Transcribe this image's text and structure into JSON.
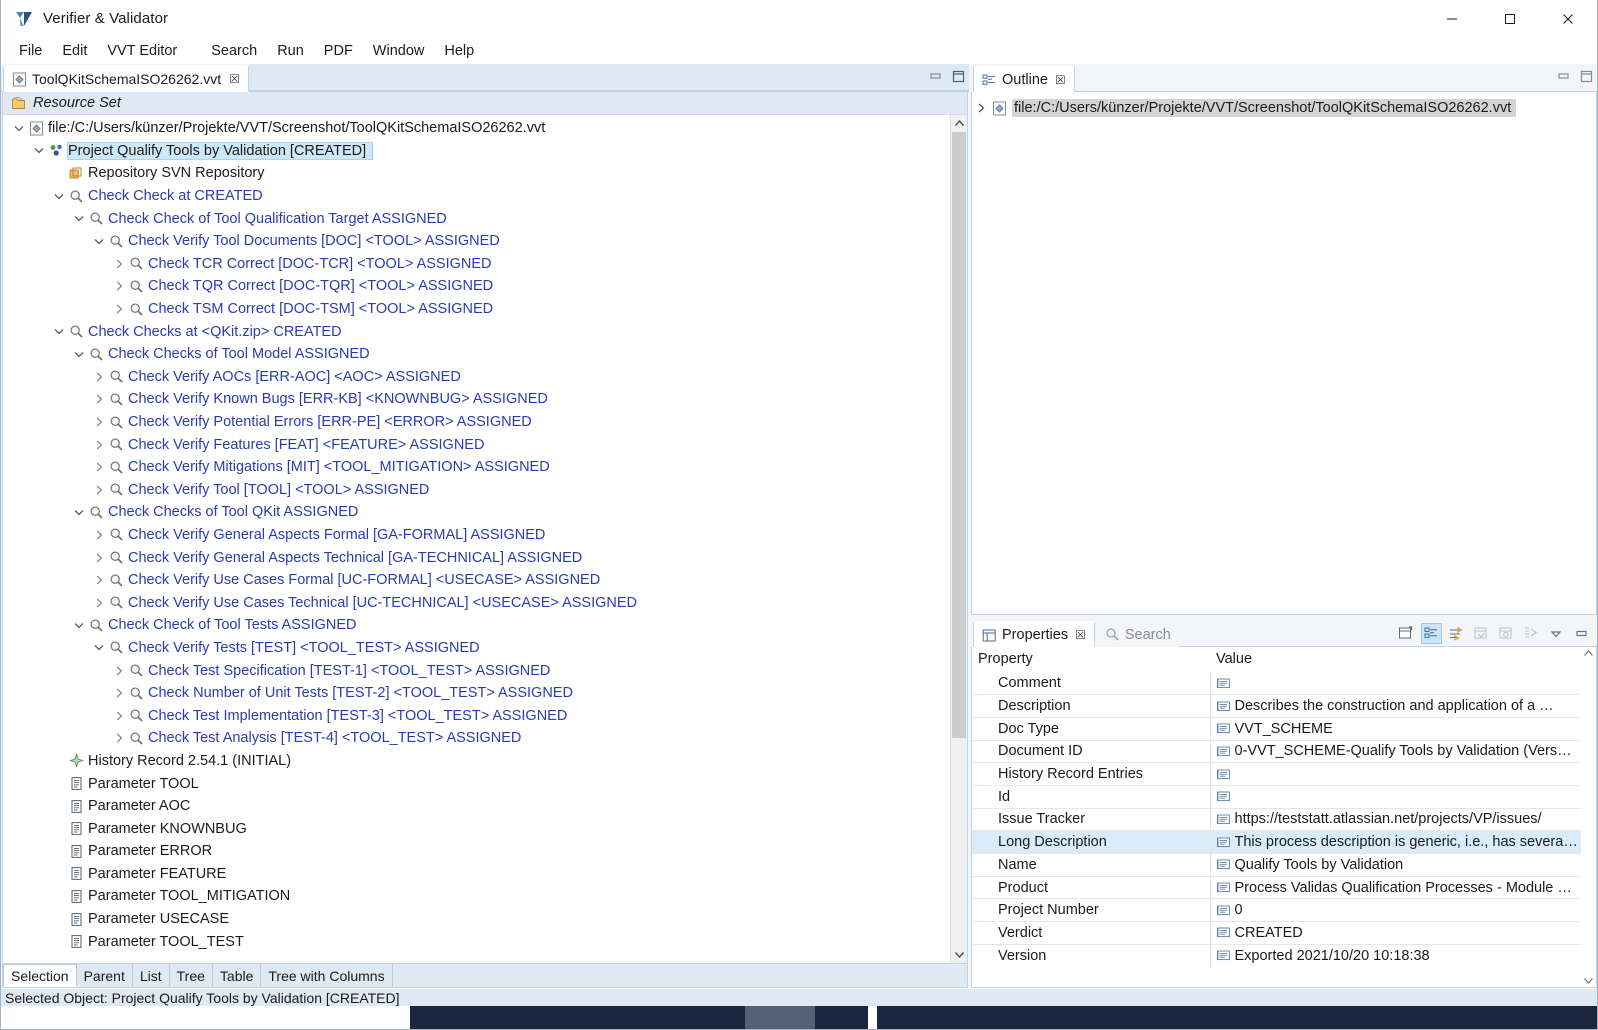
{
  "window": {
    "title": "Verifier & Validator",
    "app_icon": "vvt-logo-icon",
    "minimize": "minimize-icon",
    "maximize": "maximize-icon",
    "close": "close-icon"
  },
  "menubar": {
    "items": [
      "File",
      "Edit",
      "VVT Editor",
      "Search",
      "Run",
      "PDF",
      "Window",
      "Help"
    ]
  },
  "editor": {
    "tab": {
      "label": "ToolQKitSchemaISO26262.vvt",
      "close": "☒"
    },
    "resource_set_label": "Resource Set",
    "tree": [
      {
        "indent": 0,
        "twisty": "down",
        "icon": "resource-file-icon",
        "label": "file:/C:/Users/künzer/Projekte/VVT/Screenshot/ToolQKitSchemaISO26262.vvt",
        "color": "dark",
        "selected": false
      },
      {
        "indent": 1,
        "twisty": "down",
        "icon": "project-icon",
        "label": "Project Qualify Tools by Validation [CREATED]",
        "color": "dark",
        "selected": true
      },
      {
        "indent": 2,
        "twisty": "none",
        "icon": "repository-icon",
        "label": "Repository SVN Repository",
        "color": "dark",
        "selected": false
      },
      {
        "indent": 2,
        "twisty": "down",
        "icon": "check-icon",
        "label": "Check Check at  CREATED",
        "color": "blue",
        "selected": false
      },
      {
        "indent": 3,
        "twisty": "down",
        "icon": "check-icon",
        "label": "Check Check of Tool Qualification Target ASSIGNED",
        "color": "blue",
        "selected": false
      },
      {
        "indent": 4,
        "twisty": "down",
        "icon": "check-icon",
        "label": "Check Verify Tool Documents [DOC] <TOOL> ASSIGNED",
        "color": "blue",
        "selected": false
      },
      {
        "indent": 5,
        "twisty": "right",
        "icon": "check-icon",
        "label": "Check TCR Correct [DOC-TCR] <TOOL> ASSIGNED",
        "color": "blue",
        "selected": false
      },
      {
        "indent": 5,
        "twisty": "right",
        "icon": "check-icon",
        "label": "Check TQR Correct [DOC-TQR] <TOOL> ASSIGNED",
        "color": "blue",
        "selected": false
      },
      {
        "indent": 5,
        "twisty": "right",
        "icon": "check-icon",
        "label": "Check TSM Correct [DOC-TSM] <TOOL> ASSIGNED",
        "color": "blue",
        "selected": false
      },
      {
        "indent": 2,
        "twisty": "down",
        "icon": "check-icon",
        "label": "Check Checks at <QKit.zip> CREATED",
        "color": "blue",
        "selected": false
      },
      {
        "indent": 3,
        "twisty": "down",
        "icon": "check-icon",
        "label": "Check Checks of Tool Model ASSIGNED",
        "color": "blue",
        "selected": false
      },
      {
        "indent": 4,
        "twisty": "right",
        "icon": "check-icon",
        "label": "Check Verify AOCs [ERR-AOC] <AOC> ASSIGNED",
        "color": "blue",
        "selected": false
      },
      {
        "indent": 4,
        "twisty": "right",
        "icon": "check-icon",
        "label": "Check Verify Known Bugs [ERR-KB] <KNOWNBUG> ASSIGNED",
        "color": "blue",
        "selected": false
      },
      {
        "indent": 4,
        "twisty": "right",
        "icon": "check-icon",
        "label": "Check Verify Potential Errors [ERR-PE] <ERROR> ASSIGNED",
        "color": "blue",
        "selected": false
      },
      {
        "indent": 4,
        "twisty": "right",
        "icon": "check-icon",
        "label": "Check Verify Features [FEAT] <FEATURE> ASSIGNED",
        "color": "blue",
        "selected": false
      },
      {
        "indent": 4,
        "twisty": "right",
        "icon": "check-icon",
        "label": "Check Verify Mitigations [MIT] <TOOL_MITIGATION> ASSIGNED",
        "color": "blue",
        "selected": false
      },
      {
        "indent": 4,
        "twisty": "right",
        "icon": "check-icon",
        "label": "Check Verify Tool [TOOL] <TOOL> ASSIGNED",
        "color": "blue",
        "selected": false
      },
      {
        "indent": 3,
        "twisty": "down",
        "icon": "check-icon",
        "label": "Check Checks of Tool QKit ASSIGNED",
        "color": "blue",
        "selected": false
      },
      {
        "indent": 4,
        "twisty": "right",
        "icon": "check-icon",
        "label": "Check Verify General Aspects Formal [GA-FORMAL] ASSIGNED",
        "color": "blue",
        "selected": false
      },
      {
        "indent": 4,
        "twisty": "right",
        "icon": "check-icon",
        "label": "Check Verify General Aspects Technical [GA-TECHNICAL] ASSIGNED",
        "color": "blue",
        "selected": false
      },
      {
        "indent": 4,
        "twisty": "right",
        "icon": "check-icon",
        "label": "Check Verify Use Cases Formal [UC-FORMAL] <USECASE> ASSIGNED",
        "color": "blue",
        "selected": false
      },
      {
        "indent": 4,
        "twisty": "right",
        "icon": "check-icon",
        "label": "Check Verify Use Cases Technical [UC-TECHNICAL] <USECASE> ASSIGNED",
        "color": "blue",
        "selected": false
      },
      {
        "indent": 3,
        "twisty": "down",
        "icon": "check-icon",
        "label": "Check Check of Tool Tests ASSIGNED",
        "color": "blue",
        "selected": false
      },
      {
        "indent": 4,
        "twisty": "down",
        "icon": "check-icon",
        "label": "Check Verify Tests [TEST] <TOOL_TEST> ASSIGNED",
        "color": "blue",
        "selected": false
      },
      {
        "indent": 5,
        "twisty": "right",
        "icon": "check-icon",
        "label": "Check Test Specification [TEST-1] <TOOL_TEST> ASSIGNED",
        "color": "blue",
        "selected": false
      },
      {
        "indent": 5,
        "twisty": "right",
        "icon": "check-icon",
        "label": "Check Number of Unit Tests [TEST-2] <TOOL_TEST> ASSIGNED",
        "color": "blue",
        "selected": false
      },
      {
        "indent": 5,
        "twisty": "right",
        "icon": "check-icon",
        "label": "Check Test Implementation [TEST-3] <TOOL_TEST> ASSIGNED",
        "color": "blue",
        "selected": false
      },
      {
        "indent": 5,
        "twisty": "right",
        "icon": "check-icon",
        "label": "Check Test Analysis [TEST-4] <TOOL_TEST> ASSIGNED",
        "color": "blue",
        "selected": false
      },
      {
        "indent": 2,
        "twisty": "none",
        "icon": "history-record-icon",
        "label": "History Record 2.54.1 (INITIAL)",
        "color": "dark",
        "selected": false
      },
      {
        "indent": 2,
        "twisty": "none",
        "icon": "parameter-icon",
        "label": "Parameter TOOL",
        "color": "dark",
        "selected": false
      },
      {
        "indent": 2,
        "twisty": "none",
        "icon": "parameter-icon",
        "label": "Parameter AOC",
        "color": "dark",
        "selected": false
      },
      {
        "indent": 2,
        "twisty": "none",
        "icon": "parameter-icon",
        "label": "Parameter KNOWNBUG",
        "color": "dark",
        "selected": false
      },
      {
        "indent": 2,
        "twisty": "none",
        "icon": "parameter-icon",
        "label": "Parameter ERROR",
        "color": "dark",
        "selected": false
      },
      {
        "indent": 2,
        "twisty": "none",
        "icon": "parameter-icon",
        "label": "Parameter FEATURE",
        "color": "dark",
        "selected": false
      },
      {
        "indent": 2,
        "twisty": "none",
        "icon": "parameter-icon",
        "label": "Parameter TOOL_MITIGATION",
        "color": "dark",
        "selected": false
      },
      {
        "indent": 2,
        "twisty": "none",
        "icon": "parameter-icon",
        "label": "Parameter USECASE",
        "color": "dark",
        "selected": false
      },
      {
        "indent": 2,
        "twisty": "none",
        "icon": "parameter-icon",
        "label": "Parameter TOOL_TEST",
        "color": "dark",
        "selected": false
      }
    ],
    "view_tabs": [
      {
        "label": "Selection",
        "active": true
      },
      {
        "label": "Parent",
        "active": false
      },
      {
        "label": "List",
        "active": false
      },
      {
        "label": "Tree",
        "active": false
      },
      {
        "label": "Table",
        "active": false
      },
      {
        "label": "Tree with Columns",
        "active": false
      }
    ]
  },
  "outline": {
    "tab_label": "Outline",
    "tab_close": "☒",
    "root_label": "file:/C:/Users/künzer/Projekte/VVT/Screenshot/ToolQKitSchemaISO26262.vvt"
  },
  "properties": {
    "tab_label": "Properties",
    "tab_close": "☒",
    "search_tab_label": "Search",
    "toolbar": [
      {
        "name": "new-properties-view-icon",
        "active": false
      },
      {
        "name": "show-categories-icon",
        "active": true
      },
      {
        "name": "show-advanced-properties-icon",
        "active": false
      },
      {
        "name": "restore-default-value-icon",
        "active": false
      },
      {
        "name": "copy-property-icon",
        "active": false
      },
      {
        "name": "pin-to-selection-icon",
        "active": false
      },
      {
        "name": "view-menu-icon",
        "active": false
      },
      {
        "name": "minimize-view-icon",
        "active": false
      }
    ],
    "columns": [
      "Property",
      "Value"
    ],
    "rows": [
      {
        "property": "Comment",
        "value": "",
        "highlight": false
      },
      {
        "property": "Description",
        "value": "Describes the construction and application of a …",
        "highlight": false
      },
      {
        "property": "Doc Type",
        "value": "VVT_SCHEME",
        "highlight": false
      },
      {
        "property": "Document ID",
        "value": "0-VVT_SCHEME-Qualify Tools by Validation (Vers…",
        "highlight": false
      },
      {
        "property": "History Record Entries",
        "value": "",
        "highlight": false
      },
      {
        "property": "Id",
        "value": "",
        "highlight": false
      },
      {
        "property": "Issue Tracker",
        "value": "https://teststatt.atlassian.net/projects/VP/issues/",
        "highlight": false
      },
      {
        "property": "Long Description",
        "value": "This process description is generic, i.e., has severa…",
        "highlight": true
      },
      {
        "property": "Name",
        "value": "Qualify Tools by Validation",
        "highlight": false
      },
      {
        "property": "Product",
        "value": "Process Validas Qualification Processes - Module …",
        "highlight": false
      },
      {
        "property": "Project Number",
        "value": "0",
        "highlight": false,
        "icon": "number-value-icon"
      },
      {
        "property": "Verdict",
        "value": "CREATED",
        "highlight": false
      },
      {
        "property": "Version",
        "value": "Exported 2021/10/20 10:18:38",
        "highlight": false
      }
    ]
  },
  "statusbar": {
    "text": "Selected Object: Project Qualify Tools by Validation [CREATED]"
  },
  "colors": {
    "tree_link": "#2a3cb0",
    "selection": "#cfe8f7",
    "panel_bg": "#dfe9f3",
    "accent_toolbar": "#cce4f7",
    "taskbar": "#1d2641"
  }
}
